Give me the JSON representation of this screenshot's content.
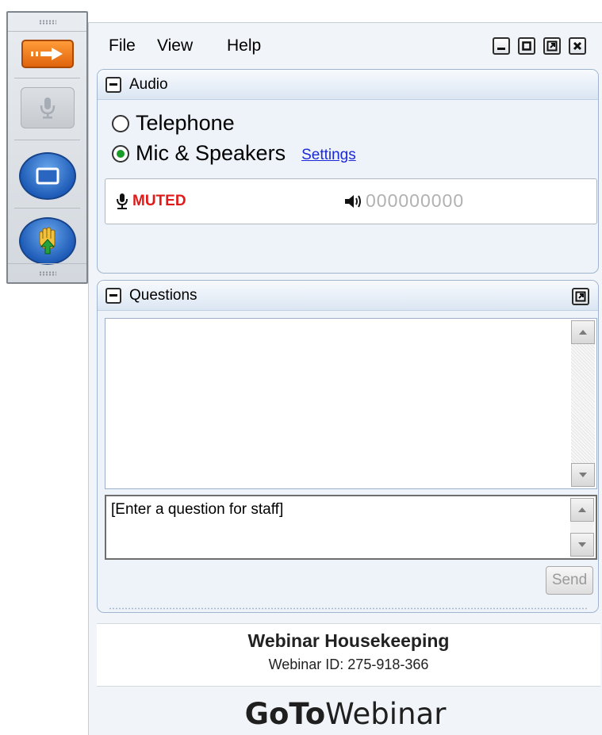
{
  "toolbar": {
    "icons": [
      "show-panel-arrow-icon",
      "microphone-icon",
      "screen-icon",
      "raise-hand-icon"
    ]
  },
  "menu": {
    "file": "File",
    "view": "View",
    "help": "Help"
  },
  "window_controls": [
    "minimize-icon",
    "maximize-icon",
    "popout-icon",
    "close-icon"
  ],
  "audio": {
    "title": "Audio",
    "options": [
      {
        "label": "Telephone",
        "selected": false
      },
      {
        "label": "Mic & Speakers",
        "selected": true
      }
    ],
    "settings_link": "Settings",
    "status": "MUTED",
    "level_meter": "000000000",
    "status_color": "#e01919"
  },
  "questions": {
    "title": "Questions",
    "input_placeholder": "[Enter a question for staff]",
    "send_label": "Send"
  },
  "webinar": {
    "title": "Webinar Housekeeping",
    "id_text": "Webinar ID: 275-918-366"
  },
  "brand": {
    "part_bold": "GoTo",
    "part_light": "Webinar"
  }
}
